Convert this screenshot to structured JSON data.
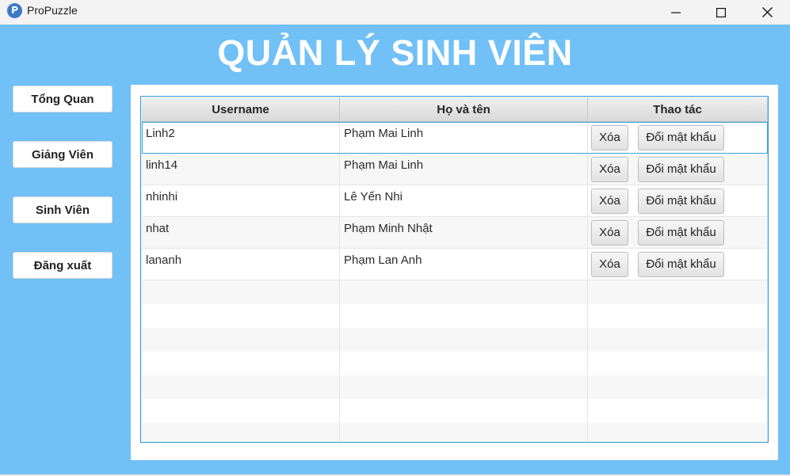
{
  "window": {
    "app_title": "ProPuzzle",
    "app_icon_letter": "P"
  },
  "header": {
    "title": "QUẢN LÝ SINH VIÊN"
  },
  "sidebar": {
    "items": [
      {
        "label": "Tổng Quan"
      },
      {
        "label": "Giảng Viên"
      },
      {
        "label": "Sinh Viên"
      },
      {
        "label": "Đăng xuất"
      }
    ]
  },
  "table": {
    "columns": [
      "Username",
      "Họ và tên",
      "Thao tác"
    ],
    "rows": [
      {
        "username": "Linh2",
        "fullname": "Phạm Mai Linh",
        "delete_label": "Xóa",
        "change_password_label": "Đổi mật khẩu"
      },
      {
        "username": "linh14",
        "fullname": "Phạm Mai Linh",
        "delete_label": "Xóa",
        "change_password_label": "Đổi mật khẩu"
      },
      {
        "username": "nhinhi",
        "fullname": "Lê Yến Nhi",
        "delete_label": "Xóa",
        "change_password_label": "Đổi mật khẩu"
      },
      {
        "username": "nhat",
        "fullname": "Phạm Minh Nhật",
        "delete_label": "Xóa",
        "change_password_label": "Đổi mật khẩu"
      },
      {
        "username": "lananh",
        "fullname": "Phạm Lan Anh",
        "delete_label": "Xóa",
        "change_password_label": "Đổi mật khẩu"
      }
    ],
    "selected_row": 0
  },
  "colors": {
    "background_blue": "#71c0f6",
    "table_border": "#2d9bd6"
  },
  "icons": {
    "minimize": "minimize-icon",
    "maximize": "maximize-icon",
    "close": "close-icon"
  }
}
